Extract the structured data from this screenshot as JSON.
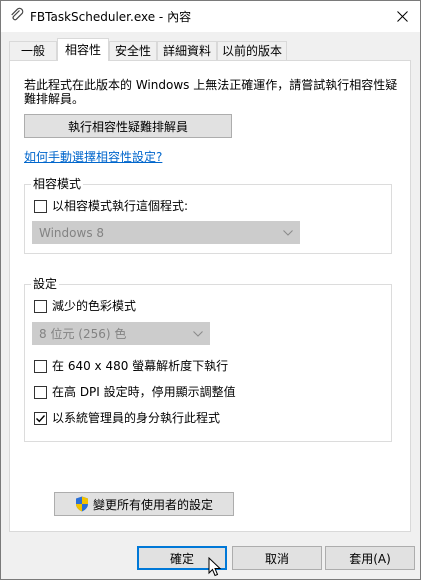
{
  "window": {
    "title": "FBTaskScheduler.exe - 內容"
  },
  "tabs": [
    {
      "label": "一般"
    },
    {
      "label": "相容性"
    },
    {
      "label": "安全性"
    },
    {
      "label": "詳細資料"
    },
    {
      "label": "以前的版本"
    }
  ],
  "compat": {
    "description": "若此程式在此版本的 Windows 上無法正確運作，請嘗試執行相容性疑難排解員。",
    "troubleshooter_button": "執行相容性疑難排解員",
    "manual_link": "如何手動選擇相容性設定?"
  },
  "compat_mode": {
    "group_title": "相容模式",
    "checkbox_label": "以相容模式執行這個程式:",
    "checked": false,
    "os_value": "Windows 8"
  },
  "settings": {
    "group_title": "設定",
    "reduced_color": {
      "label": "減少的色彩模式",
      "checked": false
    },
    "color_value": "8 位元 (256) 色",
    "res_640": {
      "label": "在 640 x 480 螢幕解析度下執行",
      "checked": false
    },
    "high_dpi": {
      "label": "在高 DPI 設定時，停用顯示調整值",
      "checked": false
    },
    "run_admin": {
      "label": "以系統管理員的身分執行此程式",
      "checked": true
    }
  },
  "all_users_button": "變更所有使用者的設定",
  "footer": {
    "ok": "確定",
    "cancel": "取消",
    "apply": "套用(A)"
  },
  "colors": {
    "accent": "#0078d7",
    "link": "#0066cc",
    "shield_blue": "#2b6fd6",
    "shield_yellow": "#f2c200"
  }
}
